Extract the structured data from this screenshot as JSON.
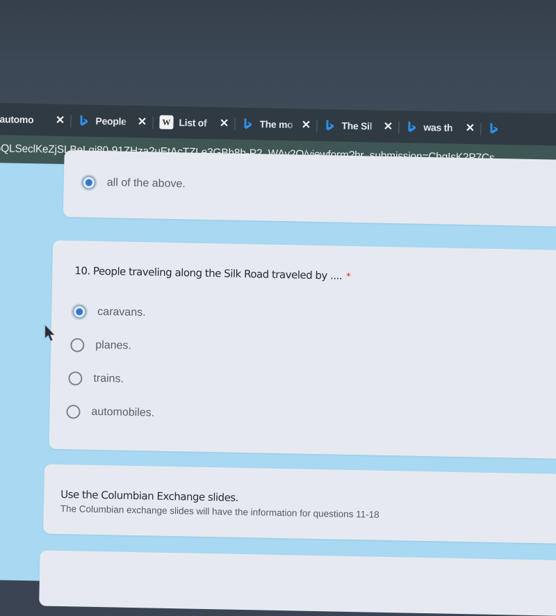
{
  "browser": {
    "tabs": [
      {
        "title": "automo",
        "icon": "generic-tab-icon",
        "close": "✕"
      },
      {
        "title": "People",
        "icon": "bing-icon",
        "close": "✕"
      },
      {
        "title": "List of",
        "icon": "wikipedia-icon",
        "close": "✕"
      },
      {
        "title": "The mo",
        "icon": "bing-icon",
        "close": "✕"
      },
      {
        "title": "The Sil",
        "icon": "bing-icon",
        "close": "✕"
      },
      {
        "title": "was th",
        "icon": "bing-icon",
        "close": "✕"
      },
      {
        "title": "",
        "icon": "bing-icon",
        "close": ""
      }
    ],
    "wikipedia_icon_glyph": "W",
    "url": "oQLSeclKeZjSLBeLgi80-91ZHza2uEtAcTZLe3GBh8b-P2_WAy2Q/viewform?hr_submission=ChgIsK2P7Cs"
  },
  "form": {
    "previous_question": {
      "options": [
        {
          "label": "all of the above.",
          "selected": true
        }
      ]
    },
    "question_10": {
      "title": "10. People traveling along the Silk Road traveled by ....",
      "required_marker": "*",
      "options": [
        {
          "label": "caravans.",
          "selected": true
        },
        {
          "label": "planes.",
          "selected": false
        },
        {
          "label": "trains.",
          "selected": false
        },
        {
          "label": "automobiles.",
          "selected": false
        }
      ]
    },
    "section": {
      "title": "Use the Columbian Exchange slides.",
      "description": "The Columbian exchange slides will have the information for questions 11-18"
    }
  },
  "colors": {
    "page_background": "#a8d8f2",
    "card_background": "#e6eaf0",
    "radio_selected": "#2f78d0",
    "required": "#d93025",
    "tab_bar": "#2f3a42",
    "url_bar": "#3f5754"
  }
}
